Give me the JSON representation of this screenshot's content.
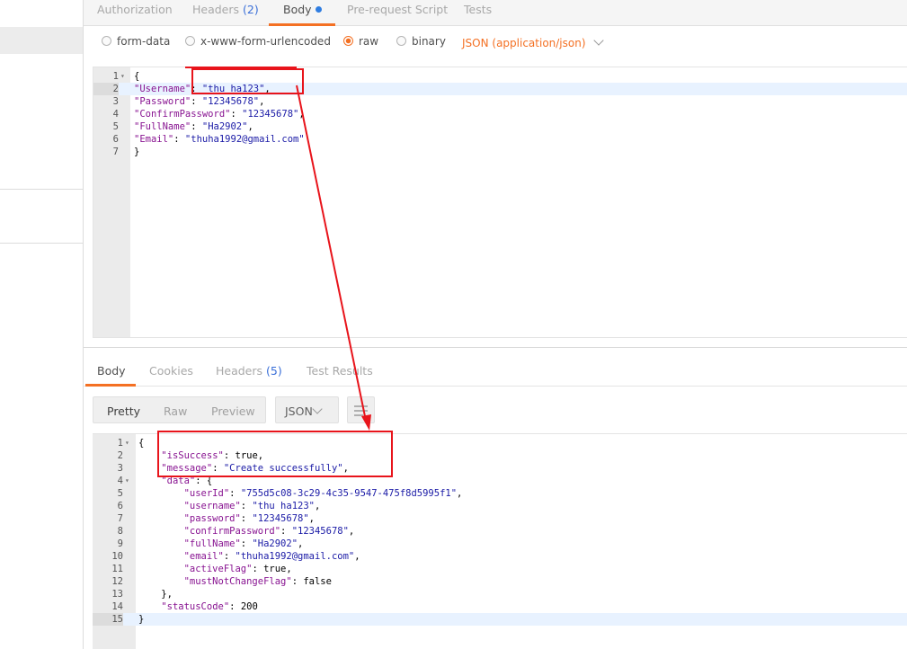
{
  "request": {
    "tabs": [
      {
        "label": "Authorization",
        "count": "",
        "active": false
      },
      {
        "label": "Headers",
        "count": "(2)",
        "active": false
      },
      {
        "label": "Body",
        "count": "",
        "active": true
      },
      {
        "label": "Pre-request Script",
        "count": "",
        "active": false
      },
      {
        "label": "Tests",
        "count": "",
        "active": false
      }
    ],
    "body_types": [
      "form-data",
      "x-www-form-urlencoded",
      "raw",
      "binary"
    ],
    "selected_body_type": "raw",
    "content_type": "JSON (application/json)",
    "editor_lines": [
      {
        "num": "1",
        "fold": "▾",
        "text": "{"
      },
      {
        "num": "2",
        "fold": "",
        "key": "\"Username\"",
        "value": "\"thu ha123\"",
        "tail": ","
      },
      {
        "num": "3",
        "fold": "",
        "key": "\"Password\"",
        "value": "\"12345678\"",
        "tail": ","
      },
      {
        "num": "4",
        "fold": "",
        "key": "\"ConfirmPassword\"",
        "value": "\"12345678\"",
        "tail": ","
      },
      {
        "num": "5",
        "fold": "",
        "key": "\"FullName\"",
        "value": "\"Ha2902\"",
        "tail": ","
      },
      {
        "num": "6",
        "fold": "",
        "key": "\"Email\"",
        "value": "\"thuha1992@gmail.com\"",
        "tail": ""
      },
      {
        "num": "7",
        "fold": "",
        "text": "}"
      }
    ]
  },
  "response": {
    "tabs": [
      {
        "label": "Body",
        "count": "",
        "active": true
      },
      {
        "label": "Cookies",
        "count": "",
        "active": false
      },
      {
        "label": "Headers",
        "count": "(5)",
        "active": false
      },
      {
        "label": "Test Results",
        "count": "",
        "active": false
      }
    ],
    "views": [
      "Pretty",
      "Raw",
      "Preview"
    ],
    "selected_view": "Pretty",
    "format": "JSON",
    "editor_lines": [
      {
        "num": "1",
        "fold": "▾",
        "text": "{"
      },
      {
        "num": "2",
        "fold": "",
        "indent": "    ",
        "key": "\"isSuccess\"",
        "value": "true",
        "tail": ","
      },
      {
        "num": "3",
        "fold": "",
        "indent": "    ",
        "key": "\"message\"",
        "value": "\"Create successfully\"",
        "tail": ","
      },
      {
        "num": "4",
        "fold": "▾",
        "indent": "    ",
        "key": "\"data\"",
        "value": "{",
        "tail": ""
      },
      {
        "num": "5",
        "fold": "",
        "indent": "        ",
        "key": "\"userId\"",
        "value": "\"755d5c08-3c29-4c35-9547-475f8d5995f1\"",
        "tail": ","
      },
      {
        "num": "6",
        "fold": "",
        "indent": "        ",
        "key": "\"username\"",
        "value": "\"thu ha123\"",
        "tail": ","
      },
      {
        "num": "7",
        "fold": "",
        "indent": "        ",
        "key": "\"password\"",
        "value": "\"12345678\"",
        "tail": ","
      },
      {
        "num": "8",
        "fold": "",
        "indent": "        ",
        "key": "\"confirmPassword\"",
        "value": "\"12345678\"",
        "tail": ","
      },
      {
        "num": "9",
        "fold": "",
        "indent": "        ",
        "key": "\"fullName\"",
        "value": "\"Ha2902\"",
        "tail": ","
      },
      {
        "num": "10",
        "fold": "",
        "indent": "        ",
        "key": "\"email\"",
        "value": "\"thuha1992@gmail.com\"",
        "tail": ","
      },
      {
        "num": "11",
        "fold": "",
        "indent": "        ",
        "key": "\"activeFlag\"",
        "value": "true",
        "tail": ","
      },
      {
        "num": "12",
        "fold": "",
        "indent": "        ",
        "key": "\"mustNotChangeFlag\"",
        "value": "false",
        "tail": ""
      },
      {
        "num": "13",
        "fold": "",
        "text": "    },"
      },
      {
        "num": "14",
        "fold": "",
        "indent": "    ",
        "key": "\"statusCode\"",
        "value": "200",
        "tail": ""
      },
      {
        "num": "15",
        "fold": "",
        "text": "}"
      }
    ]
  },
  "colors": {
    "accent": "#f47023",
    "annotation": "#e8141b",
    "key": "#881391",
    "string": "#1a1aa6"
  },
  "icons": {
    "wrap": "wrap-lines-icon",
    "dropdown": "chevron-down-icon"
  }
}
